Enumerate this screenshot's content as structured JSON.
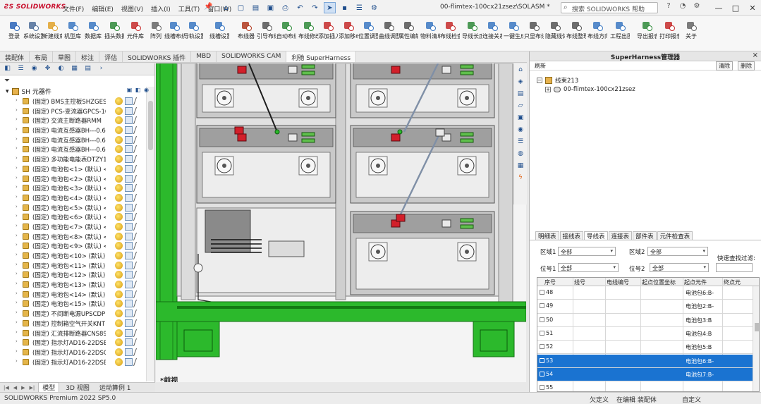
{
  "app": {
    "logo": "SOLIDWORKS",
    "menus": [
      "文件(F)",
      "编辑(E)",
      "视图(V)",
      "插入(I)",
      "工具(T)",
      "窗口(W)"
    ],
    "doc_title": "00-flimtex-100cx21zsez\\SOLASM *",
    "help_search": "搜索 SOLIDWORKS 帮助"
  },
  "ribbon": {
    "buttons": [
      {
        "label": "登录",
        "icon": "login-icon",
        "color": "#2a64b8"
      },
      {
        "label": "系统设置",
        "icon": "settings-icon",
        "color": "#4f6f9a"
      },
      {
        "label": "新建线束",
        "icon": "new-harness-icon",
        "color": "#e0a22a"
      },
      {
        "label": "机型库",
        "icon": "model-library-icon",
        "color": "#3b78c2"
      },
      {
        "label": "数据库",
        "icon": "database-icon",
        "color": "#3b78c2"
      },
      {
        "label": "插头数据",
        "icon": "connector-data-icon",
        "color": "#2f8a3a"
      },
      {
        "label": "元件库",
        "icon": "component-library-icon",
        "color": "#c62b2b"
      },
      {
        "label": "阵列",
        "icon": "array-icon",
        "color": "#666666"
      },
      {
        "label": "线槽布线",
        "icon": "trunking-icon",
        "color": "#3b78c2"
      },
      {
        "label": "导轨设置",
        "icon": "rail-icon",
        "color": "#3b78c2"
      },
      {
        "label": "线槽设置",
        "icon": "duct-settings-icon",
        "color": "#3b78c2"
      },
      {
        "label": "布线器",
        "icon": "router-icon",
        "color": "#b0391f"
      },
      {
        "label": "引导布线",
        "icon": "guide-route-icon",
        "color": "#555555"
      },
      {
        "label": "自动布线",
        "icon": "auto-route-icon",
        "color": "#2f8a3a"
      },
      {
        "label": "布线修改",
        "icon": "route-edit-icon",
        "color": "#2f8a3a"
      },
      {
        "label": "添加插入",
        "icon": "add-insert-icon",
        "color": "#c62b2b"
      },
      {
        "label": "添加移动",
        "icon": "add-move-icon",
        "color": "#c62b2b"
      },
      {
        "label": "位置调整",
        "icon": "position-adjust-icon",
        "color": "#3b78c2"
      },
      {
        "label": "曲线调整",
        "icon": "curve-adjust-icon",
        "color": "#555555"
      },
      {
        "label": "属性编辑",
        "icon": "property-edit-icon",
        "color": "#555555"
      },
      {
        "label": "物料清单",
        "icon": "bom-icon",
        "color": "#3b78c2"
      },
      {
        "label": "布线检查",
        "icon": "route-check-icon",
        "color": "#c62b2b"
      },
      {
        "label": "导线长度",
        "icon": "wire-length-icon",
        "color": "#2f8a3a"
      },
      {
        "label": "连接关系",
        "icon": "connection-icon",
        "color": "#3b78c2"
      },
      {
        "label": "一键生成",
        "icon": "one-click-icon",
        "color": "#3b78c2"
      },
      {
        "label": "只显布线",
        "icon": "show-route-icon",
        "color": "#555555"
      },
      {
        "label": "隐藏线体",
        "icon": "hide-wire-icon",
        "color": "#555555"
      },
      {
        "label": "布线整理",
        "icon": "tidy-icon",
        "color": "#555555"
      },
      {
        "label": "布线方向",
        "icon": "route-direction-icon",
        "color": "#3b78c2"
      },
      {
        "label": "工程出图",
        "icon": "drawing-icon",
        "color": "#3b78c2"
      },
      {
        "label": "导出报表",
        "icon": "export-icon",
        "color": "#2f8a3a"
      },
      {
        "label": "打印报表",
        "icon": "print-icon",
        "color": "#c62b2b"
      },
      {
        "label": "关于",
        "icon": "about-icon",
        "color": "#666666"
      }
    ]
  },
  "tabs": [
    "装配体",
    "布局",
    "草图",
    "标注",
    "评估",
    "SOLIDWORKS 插件",
    "MBD",
    "SOLIDWORKS CAM",
    "利驰 SuperHarness"
  ],
  "tree": {
    "root": "SH 元器件",
    "items": [
      "(固定) BMS主控板SHZGES",
      "(固定) PCS-变流器GPCS-100",
      "(固定) 交流主断路器RMM",
      "(固定) 电流互感器BH---0.66",
      "(固定) 电流互感器BH---0.66",
      "(固定) 电流互感器BH---0.66",
      "(固定) 多功能电能表DTZY1",
      "(固定) 电池包<1> (默认) <",
      "(固定) 电池包<2> (默认) <",
      "(固定) 电池包<3> (默认) <",
      "(固定) 电池包<4> (默认) <",
      "(固定) 电池包<5> (默认) <",
      "(固定) 电池包<6> (默认) <",
      "(固定) 电池包<7> (默认) <",
      "(固定) 电池包<8> (默认) <",
      "(固定) 电池包<9> (默认) <",
      "(固定) 电池包<10> (默认) <",
      "(固定) 电池包<11> (默认) <",
      "(固定) 电池包<12> (默认) <",
      "(固定) 电池包<13> (默认) <",
      "(固定) 电池包<14> (默认) <",
      "(固定) 电池包<15> (默认) <",
      "(固定) 不间断电源UPSCDP",
      "(固定) 控制箱空气开关KNT",
      "(固定) 汇流排断路器CNS894",
      "(固定) 指示灯AD16-22DSB",
      "(固定) 指示灯AD16-22DSC",
      "(固定) 指示灯AD16-22DSB"
    ]
  },
  "bottom_tabs": [
    "模型",
    "3D 视图",
    "运动算例 1"
  ],
  "view_label": "*前视",
  "status": {
    "app": "SOLIDWORKS Premium 2022 SP5.0",
    "s1": "欠定义",
    "s2": "在编辑 装配体",
    "s3": "自定义"
  },
  "sh_panel": {
    "title": "SuperHarness管理器",
    "toolbar_left": "刷新",
    "btn1": "清除",
    "btn2": "删除",
    "tree_root": "线束213",
    "tree_child": "00-flimtex-100cx21zsez",
    "tabs": [
      "明细表",
      "接线表",
      "导线表",
      "连接表",
      "部件表",
      "元件检查表"
    ],
    "active_tab": 2,
    "filters": {
      "l_from1": "区域1",
      "v_from1": "全部",
      "l_to1": "区域2",
      "v_to1": "全部",
      "l_from2": "位号1",
      "v_from2": "全部",
      "l_to2": "位号2",
      "v_to2": "全部",
      "l_search": "快速查找过滤:"
    },
    "columns": [
      "序号",
      "线号",
      "电线编号",
      "起点位置坐标",
      "起点元件",
      "终点元"
    ],
    "rows": [
      {
        "no": "48",
        "wire": "",
        "code": "",
        "pos": "",
        "start": "电池包6:B-",
        "end": "",
        "sel": false
      },
      {
        "no": "49",
        "wire": "",
        "code": "",
        "pos": "",
        "start": "电池包2:B-",
        "end": "",
        "sel": false
      },
      {
        "no": "50",
        "wire": "",
        "code": "",
        "pos": "",
        "start": "电池包3:B",
        "end": "",
        "sel": false
      },
      {
        "no": "51",
        "wire": "",
        "code": "",
        "pos": "",
        "start": "电池包4:B",
        "end": "",
        "sel": false
      },
      {
        "no": "52",
        "wire": "",
        "code": "",
        "pos": "",
        "start": "电池包5:B",
        "end": "",
        "sel": false
      },
      {
        "no": "53",
        "wire": "",
        "code": "",
        "pos": "",
        "start": "电池包6:B-",
        "end": "",
        "sel": true
      },
      {
        "no": "54",
        "wire": "",
        "code": "",
        "pos": "",
        "start": "电池包7:B-",
        "end": "",
        "sel": true
      },
      {
        "no": "55",
        "wire": "",
        "code": "",
        "pos": "",
        "start": "",
        "end": "",
        "sel": false
      }
    ]
  }
}
